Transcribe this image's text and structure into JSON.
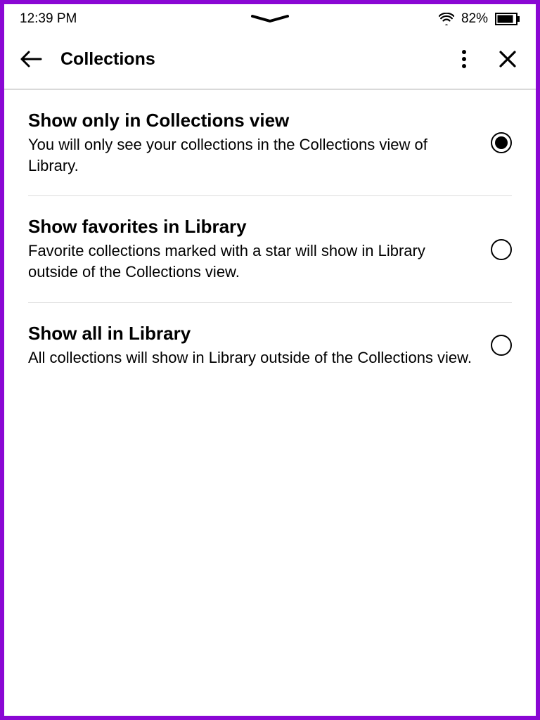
{
  "status": {
    "time": "12:39 PM",
    "battery_pct": "82%"
  },
  "header": {
    "title": "Collections"
  },
  "options": [
    {
      "title": "Show only in Collections view",
      "desc": "You will only see your collections in the Collections view of Library.",
      "selected": true
    },
    {
      "title": "Show favorites in Library",
      "desc": "Favorite collections marked with a star will show in Library outside of the Collections view.",
      "selected": false
    },
    {
      "title": "Show all in Library",
      "desc": "All collections will show in Library outside of the Collections view.",
      "selected": false
    }
  ]
}
